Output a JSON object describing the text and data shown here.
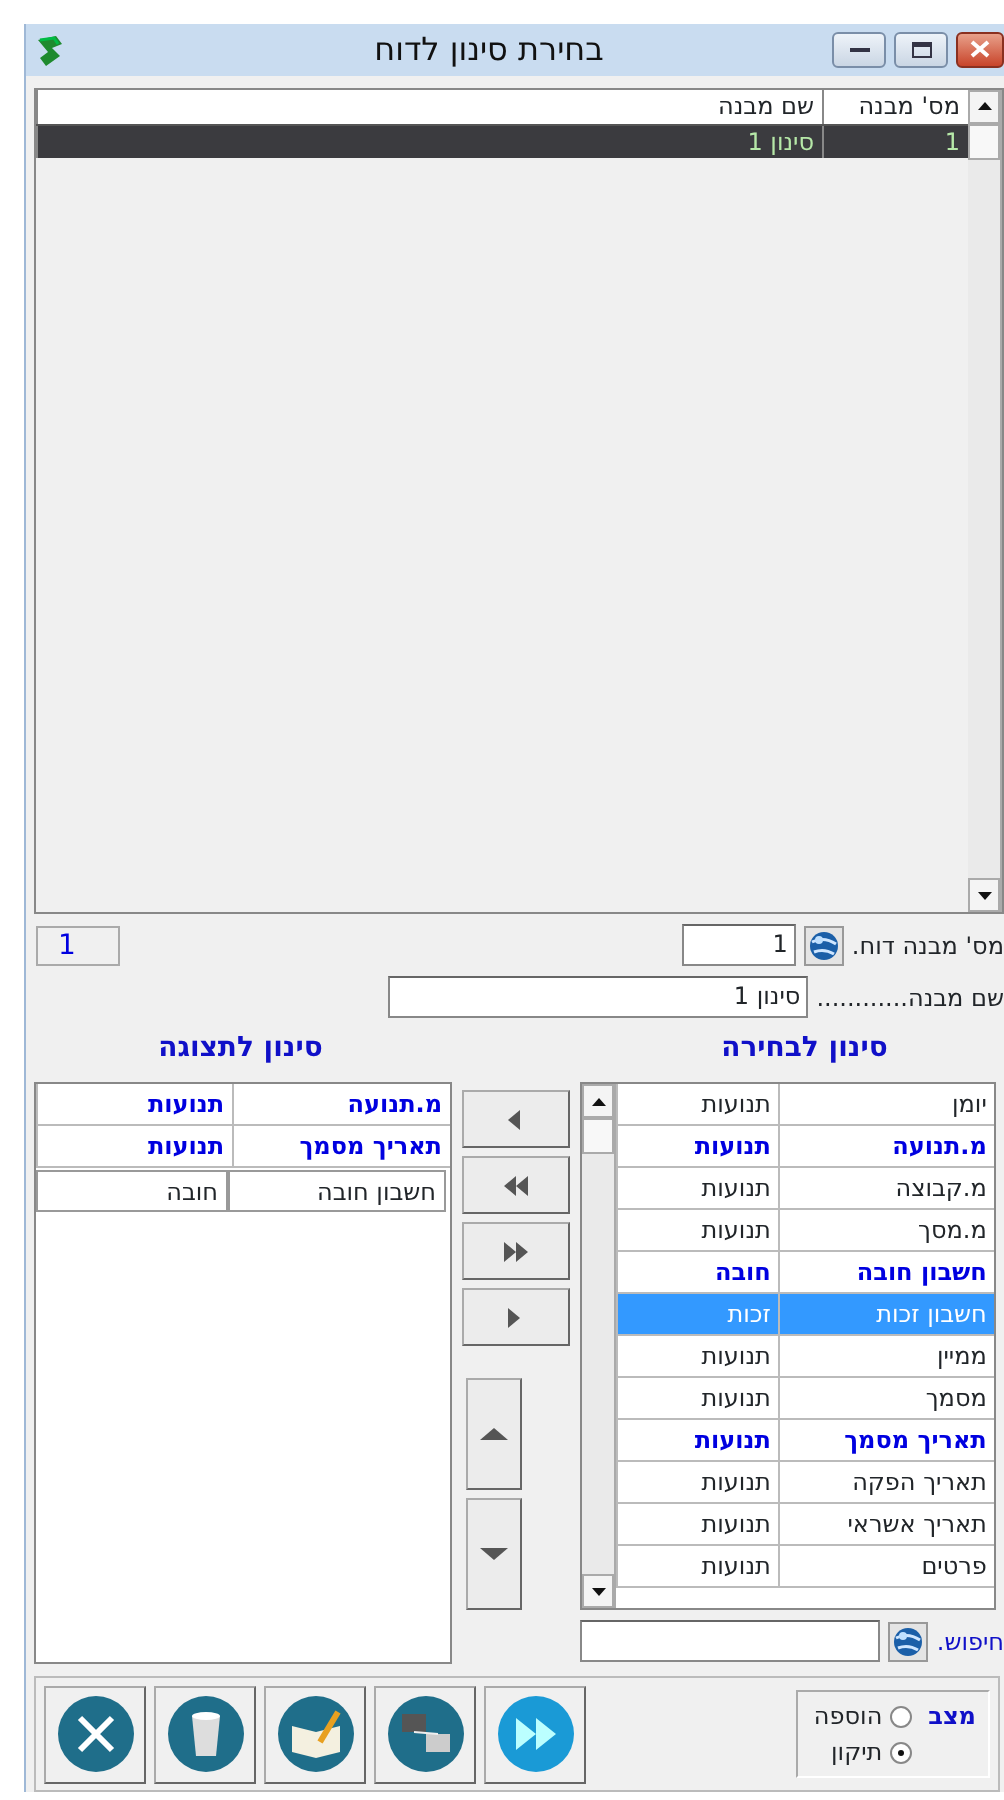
{
  "window": {
    "title": "בחירת סינון לדוח"
  },
  "structures_table": {
    "columns": [
      "מס' מבנה",
      "שם מבנה"
    ],
    "rows": [
      {
        "cells": [
          "1",
          "סינון 1"
        ],
        "selected": true
      }
    ]
  },
  "record_counter": "1",
  "report_structure_number": {
    "label": "מס' מבנה דוח.",
    "value": "1"
  },
  "structure_name": {
    "label": "שם מבנה............",
    "value": "סינון 1"
  },
  "display_filter": {
    "title": "סינון לתצוגה",
    "rows": [
      {
        "name": "מ.תנועה",
        "value": "תנועות",
        "emphasized": true
      },
      {
        "name": "תאריך מסמך",
        "value": "תנועות",
        "emphasized": true
      },
      {
        "name": "חשבון חובה",
        "value": "חובה",
        "emphasized": false
      }
    ]
  },
  "transfer_buttons": [
    {
      "kind": "left"
    },
    {
      "kind": "double-left"
    },
    {
      "kind": "double-right"
    },
    {
      "kind": "right"
    }
  ],
  "order_buttons": [
    {
      "kind": "up"
    },
    {
      "kind": "down"
    }
  ],
  "selection_filter": {
    "title": "סינון לבחירה",
    "rows": [
      {
        "name": "יומן",
        "value": "תנועות",
        "emphasized": false,
        "selected": false
      },
      {
        "name": "מ.תנועה",
        "value": "תנועות",
        "emphasized": true,
        "selected": false
      },
      {
        "name": "מ.קבוצה",
        "value": "תנועות",
        "emphasized": false,
        "selected": false
      },
      {
        "name": "מ.מסך",
        "value": "תנועות",
        "emphasized": false,
        "selected": false
      },
      {
        "name": "חשבון חובה",
        "value": "חובה",
        "emphasized": true,
        "selected": false
      },
      {
        "name": "חשבון זכות",
        "value": "זכות",
        "emphasized": false,
        "selected": true
      },
      {
        "name": "ממיין",
        "value": "תנועות",
        "emphasized": false,
        "selected": false
      },
      {
        "name": "מסמך",
        "value": "תנועות",
        "emphasized": false,
        "selected": false
      },
      {
        "name": "תאריך מסמך",
        "value": "תנועות",
        "emphasized": true,
        "selected": false
      },
      {
        "name": "תאריך הפקה",
        "value": "תנועות",
        "emphasized": false,
        "selected": false
      },
      {
        "name": "תאריך אשראי",
        "value": "תנועות",
        "emphasized": false,
        "selected": false
      },
      {
        "name": "פרטים",
        "value": "תנועות",
        "emphasized": false,
        "selected": false
      }
    ]
  },
  "search": {
    "label": "חיפוש."
  },
  "mode": {
    "label": "מצב",
    "options": [
      {
        "label": "הוספה",
        "selected": false
      },
      {
        "label": "תיקון",
        "selected": true
      }
    ]
  },
  "toolbar": [
    {
      "kind": "cancel"
    },
    {
      "kind": "delete"
    },
    {
      "kind": "edit"
    },
    {
      "kind": "network"
    },
    {
      "kind": "forward"
    }
  ]
}
